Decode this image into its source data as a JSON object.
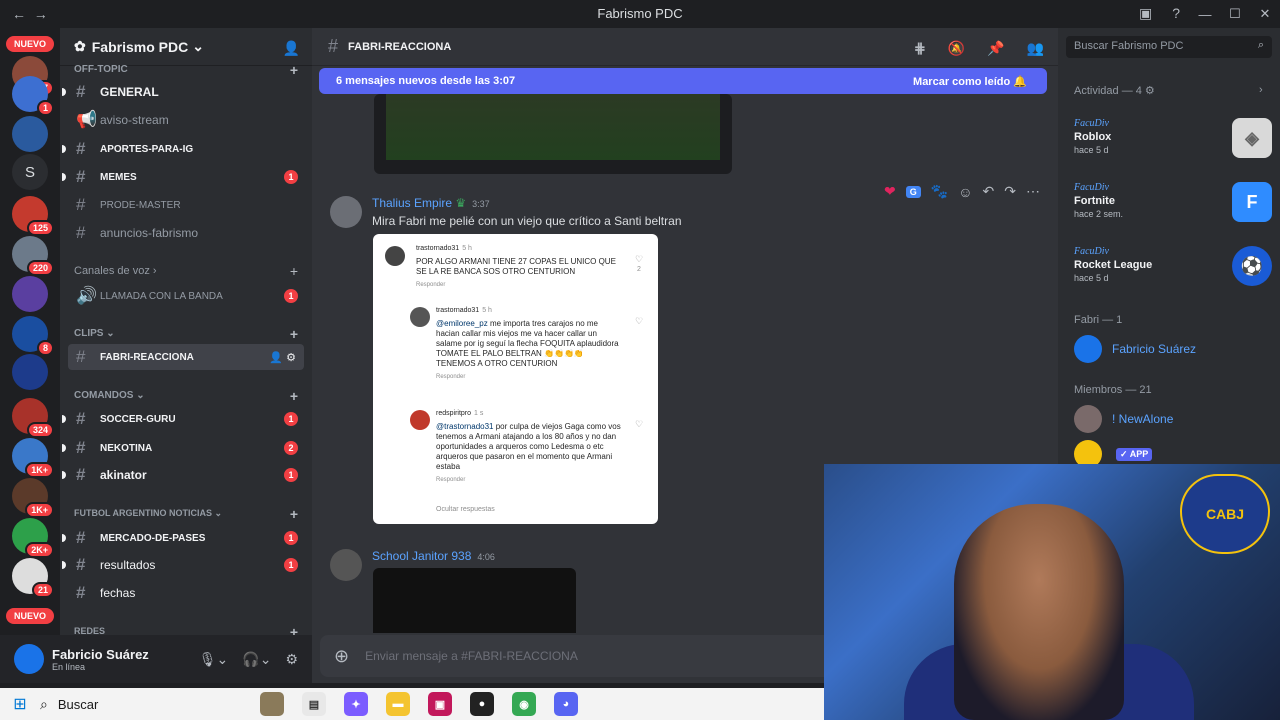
{
  "window": {
    "title": "Fabrismo PDC"
  },
  "servers": {
    "new_label": "NUEVO",
    "badges": [
      "17",
      "1",
      "125",
      "220",
      "8",
      "324",
      "1K+",
      "1K+",
      "2K+",
      "21"
    ],
    "letter": "S"
  },
  "guild": {
    "name": "Fabrismo PDC"
  },
  "channels": {
    "cat_offtopic": "off-topic",
    "items": [
      {
        "name": "GENERAL",
        "style": "unread"
      },
      {
        "name": "aviso-stream",
        "style": "normal"
      },
      {
        "name": "APORTES-PARA-IG",
        "style": "unread"
      },
      {
        "name": "MEMES",
        "style": "unread",
        "count": "1"
      },
      {
        "name": "PRODE-MASTER",
        "style": "normal"
      },
      {
        "name": "anuncios-fabrismo",
        "style": "normal"
      }
    ],
    "cat_voice": "Canales de voz",
    "voice_channel": "LLAMADA CON LA BANDA",
    "voice_count": "1",
    "cat_clips": "CLIPS",
    "active_channel": "FABRI-REACCIONA",
    "cat_comandos": "COMANDOS",
    "comandos": [
      {
        "name": "SOCCER-GURU",
        "count": "1"
      },
      {
        "name": "NEKOTINA",
        "count": "2"
      },
      {
        "name": "akinator",
        "count": "1"
      }
    ],
    "cat_noticias": "FUTBOL ARGENTINO NOTICIAS",
    "noticias": [
      {
        "name": "MERCADO-DE-PASES",
        "count": "1"
      },
      {
        "name": "resultados",
        "count": "1"
      },
      {
        "name": "fechas"
      }
    ],
    "cat_redes": "REDES"
  },
  "user": {
    "name": "Fabricio Suárez",
    "status": "En línea"
  },
  "chat": {
    "channel": "FABRI-REACCIONA",
    "new_messages": "6 mensajes nuevos desde las 3:07",
    "mark_read": "Marcar como leído",
    "messages": [
      {
        "author": "Thalius Empire",
        "time": "3:37",
        "text": "Mira Fabri me pelié con un viejo que crítico a Santi beltran"
      },
      {
        "author": "School Janitor 938",
        "time": "4:06",
        "text": ""
      }
    ],
    "composer_placeholder": "Enviar mensaje a #FABRI-REACCIONA"
  },
  "embed": {
    "comments": [
      {
        "user": "trastornado31",
        "age": "5 h",
        "text": "POR ALGO ARMANI TIENE 27 COPAS EL UNICO QUE SE LA RE BANCA SOS OTRO CENTURION",
        "reply": "Responder",
        "likes": "2"
      },
      {
        "user": "trastornado31",
        "age": "5 h",
        "mention": "@emiloree_pz",
        "text": "me importa tres carajos no me hacian callar mis viejos me va hacer callar un salame por ig seguí la flecha FOQUITA aplaudidora TOMATE EL PALO BELTRAN 👏👏👏👏 TENEMOS A OTRO CENTURION",
        "reply": "Responder"
      },
      {
        "user": "redspiritpro",
        "age": "1 s",
        "mention": "@trastornado31",
        "text": "por culpa de viejos Gaga como vos tenemos a Armani atajando a los 80 años y no dan oportunidades a arqueros como Ledesma o etc arqueros que pasaron en el momento que Armani estaba",
        "reply": "Responder"
      }
    ],
    "hide_replies": "Ocultar respuestas"
  },
  "members": {
    "search_placeholder": "Buscar Fabrismo PDC",
    "activity_header": "Actividad — 4",
    "activities": [
      {
        "user": "FacuDiv",
        "game": "Roblox",
        "since": "hace 5 d",
        "icon": "roblox-icon",
        "color": "#d9d9d9"
      },
      {
        "user": "FacuDiv",
        "game": "Fortnite",
        "since": "hace 2 sem.",
        "icon": "fortnite-icon",
        "color": "#2f8cff"
      },
      {
        "user": "FacuDiv",
        "game": "Rocket League",
        "since": "hace 5 d",
        "icon": "rocket-league-icon",
        "color": "#1a5bd6"
      }
    ],
    "fabri_header": "Fabri — 1",
    "fabri_member": "Fabricio Suárez",
    "members_header": "Miembros — 21",
    "member1": "! NewAlone",
    "app_badge": "✓ APP"
  },
  "taskbar": {
    "search": "Buscar"
  },
  "webcam": {
    "crest": "CABJ"
  }
}
